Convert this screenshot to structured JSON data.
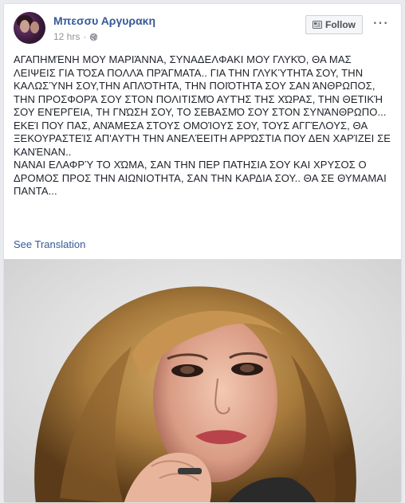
{
  "post": {
    "author": "Μπεσσυ Αργυρακη",
    "time": "12 hrs",
    "audience_icon": "globe-icon",
    "follow_label": "Follow",
    "more_icon": "more-options-icon",
    "paragraphs": [
      "ΑΓΑΠΗΜΈΝΗ ΜΟΥ ΜΑΡΙΆΝΝΑ, ΣΥΝΑΔΕΛΦΑΚΙ ΜΟΥ ΓΛΥΚΌ, ΘΑ ΜΑΣ ΛΕΙΨΕΙΣ ΓΙΑ ΤΌΣΑ ΠΟΛΛΆ ΠΡΆΓΜΑΤΑ.. ΓΙΑ ΤΗΝ ΓΛΥΚΎΤΗΤΑ ΣΟΥ, ΤΗΝ ΚΑΛΩΣΎΝΗ ΣΟΥ,ΤΗΝ ΑΠΛΌΤΗΤΑ, ΤΗΝ ΠΟΙΌΤΗΤΑ ΣΟΥ ΣΑΝ ΆΝΘΡΩΠΟΣ, ΤΗΝ ΠΡΟΣΦΟΡΆ ΣΟΥ ΣΤΟΝ ΠΟΛΙΤΙΣΜΌ ΑΥΤΉΣ ΤΗΣ ΧΏΡΑΣ, ΤΗΝ ΘΕΤΙΚΉ ΣΟΥ ΕΝΈΡΓΕΙΑ, ΤΗ ΓΝΏΣΗ ΣΟΥ, ΤΟ ΣΕΒΑΣΜΌ ΣΟΥ ΣΤΟΝ ΣΥΝΆΝΘΡΩΠΟ...",
      "ΕΚΕΊ ΠΟΥ ΠΑΣ, ΑΝΆΜΕΣΑ ΣΤΟΥΣ ΟΜΟΊΟΥΣ ΣΟΥ, ΤΟΥΣ ΑΓΓΈΛΟΥΣ, ΘΑ ΞΕΚΟΥΡΑΣΤΕΊΣ ΑΠ'ΑΥΤΉ ΤΗΝ ΑΝΕΛΈΕΙΤΗ ΑΡΡΏΣΤΙΑ ΠΟΥ ΔΕΝ ΧΑΡΊΖΕΙ ΣΕ ΚΑΝΈΝΑΝ..",
      "ΝΑΝΑΙ ΕΛΑΦΡΎ ΤΟ ΧΏΜΑ, ΣΑΝ ΤΗΝ ΠΕΡ ΠΑΤΗΣΙΑ ΣΟΥ ΚΑΙ ΧΡΥΣΟΣ Ο ΔΡΟΜΟΣ ΠΡΟΣ ΤΗΝ ΑΙΩΝΙΟΤΗΤΑ, ΣΑΝ ΤΗΝ ΚΑΡΔΙΑ ΣΟΥ.. ΘΑ ΣΕ ΘΥΜΑΜΑΙ ΠΑΝΤΑ..."
    ],
    "see_translation": "See Translation"
  },
  "colors": {
    "link": "#385898",
    "text": "#1d2129",
    "meta": "#90949c",
    "page_bg": "#e9ebee"
  }
}
